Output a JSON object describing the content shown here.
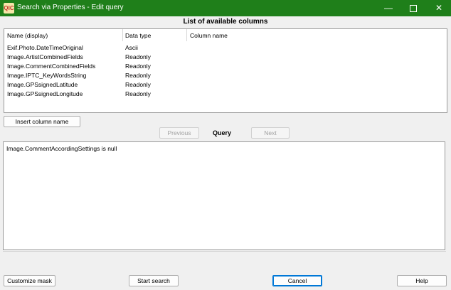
{
  "window": {
    "icon_text": "QIC",
    "title": "Search via Properties - Edit query",
    "minimize": "—",
    "close": "✕"
  },
  "columns_section": {
    "title": "List of available columns",
    "headers": [
      "Name (display)",
      "Data type",
      "Column name"
    ],
    "rows": [
      {
        "name": "Exif.Photo.DateTimeOriginal",
        "type": "Ascii"
      },
      {
        "name": "Image.ArtistCombinedFields",
        "type": "Readonly"
      },
      {
        "name": "Image.CommentCombinedFields",
        "type": "Readonly"
      },
      {
        "name": "Image.IPTC_KeyWordsString",
        "type": "Readonly"
      },
      {
        "name": "Image.GPSsignedLatitude",
        "type": "Readonly"
      },
      {
        "name": "Image.GPSsignedLongitude",
        "type": "Readonly"
      }
    ]
  },
  "buttons": {
    "insert_column": "Insert column name",
    "previous": "Previous",
    "next": "Next",
    "customize_mask": "Customize mask",
    "start_search": "Start search",
    "cancel": "Cancel",
    "help": "Help"
  },
  "query": {
    "label": "Query",
    "text": "Image.CommentAccordingSettings is null"
  }
}
